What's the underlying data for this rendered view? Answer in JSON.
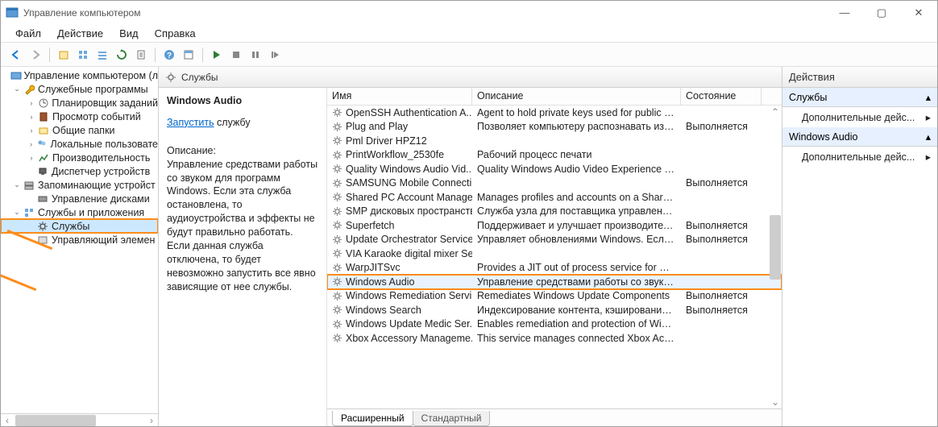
{
  "window": {
    "title": "Управление компьютером"
  },
  "menu": {
    "file": "Файл",
    "action": "Действие",
    "view": "Вид",
    "help": "Справка"
  },
  "tree": {
    "root": "Управление компьютером (л",
    "cat_util": "Служебные программы",
    "task_sched": "Планировщик заданий",
    "event_viewer": "Просмотр событий",
    "shared": "Общие папки",
    "local_users": "Локальные пользовате",
    "perf": "Производительность",
    "devmgr": "Диспетчер устройств",
    "cat_storage": "Запоминающие устройст",
    "diskmgr": "Управление дисками",
    "cat_svcapp": "Службы и приложения",
    "services": "Службы",
    "wmi": "Управляющий элемен"
  },
  "pane": {
    "header": "Службы",
    "svc_name": "Windows Audio",
    "start_link": "Запустить",
    "start_suffix": " службу",
    "desc_label": "Описание:",
    "desc_text": "Управление средствами работы со звуком для программ Windows.  Если эта служба остановлена, то аудиоустройства и эффекты не будут правильно работать.  Если данная служба отключена, то будет невозможно запустить все явно зависящие от нее службы."
  },
  "cols": {
    "name": "Имя",
    "desc": "Описание",
    "state": "Состояние"
  },
  "state_running": "Выполняется",
  "services": [
    {
      "name": "OpenSSH Authentication A...",
      "desc": "Agent to hold private keys used for public ke...",
      "state": ""
    },
    {
      "name": "Plug and Play",
      "desc": "Позволяет компьютеру распознавать изме...",
      "state": "Выполняется"
    },
    {
      "name": "Pml Driver HPZ12",
      "desc": "",
      "state": ""
    },
    {
      "name": "PrintWorkflow_2530fe",
      "desc": "Рабочий процесс печати",
      "state": ""
    },
    {
      "name": "Quality Windows Audio Vid...",
      "desc": "Quality Windows Audio Video Experience (q...",
      "state": ""
    },
    {
      "name": "SAMSUNG Mobile Connecti...",
      "desc": "",
      "state": "Выполняется"
    },
    {
      "name": "Shared PC Account Manager",
      "desc": "Manages profiles and accounts on a SharedP...",
      "state": ""
    },
    {
      "name": "SMP дисковых пространств...",
      "desc": "Служба узла для поставщика управления д...",
      "state": ""
    },
    {
      "name": "Superfetch",
      "desc": "Поддерживает и улучшает производительн...",
      "state": "Выполняется"
    },
    {
      "name": "Update Orchestrator Service",
      "desc": "Управляет обновлениями Windows. Если о...",
      "state": "Выполняется"
    },
    {
      "name": "VIA Karaoke digital mixer Se...",
      "desc": "",
      "state": ""
    },
    {
      "name": "WarpJITSvc",
      "desc": "Provides a JIT out of process service for WAR...",
      "state": ""
    },
    {
      "name": "Windows Audio",
      "desc": "Управление средствами работы со звуком ...",
      "state": "",
      "selected": true
    },
    {
      "name": "Windows Remediation Servi...",
      "desc": "Remediates Windows Update Components",
      "state": "Выполняется"
    },
    {
      "name": "Windows Search",
      "desc": "Индексирование контента, кэширование с...",
      "state": "Выполняется"
    },
    {
      "name": "Windows Update Medic Ser...",
      "desc": "Enables remediation and protection of Windo...",
      "state": ""
    },
    {
      "name": "Xbox Accessory Manageme...",
      "desc": "This service manages connected Xbox Access...",
      "state": ""
    }
  ],
  "tabs": {
    "extended": "Расширенный",
    "standard": "Стандартный"
  },
  "actions": {
    "header": "Действия",
    "section1": "Службы",
    "more": "Дополнительные дейс...",
    "section2": "Windows Audio"
  }
}
